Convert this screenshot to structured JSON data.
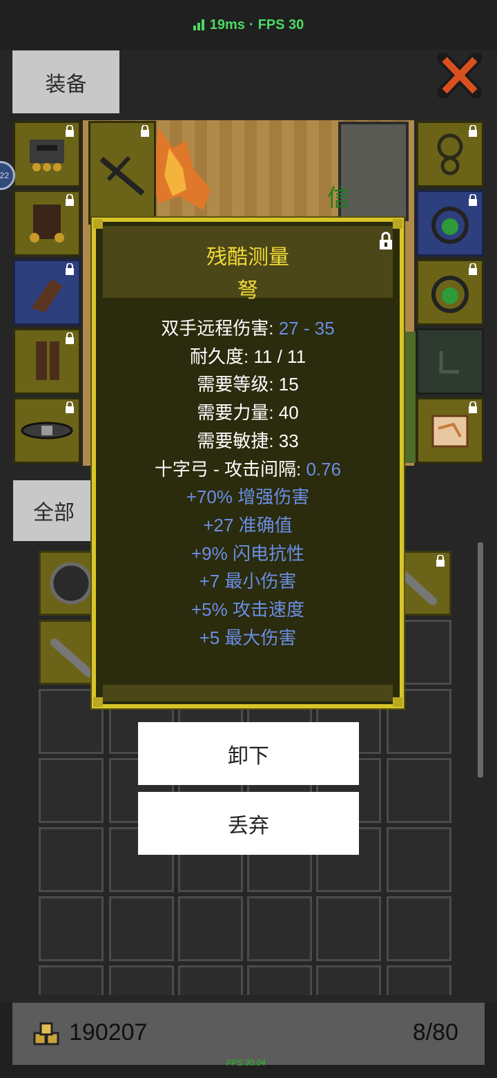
{
  "status": {
    "latency": "19ms",
    "separator": "·",
    "fps": "FPS 30"
  },
  "tabs": {
    "equipment": "装备",
    "all": "全部"
  },
  "side_badge": "22",
  "scene_text": "信",
  "tooltip": {
    "title": "残酷测量",
    "item_type": "弩",
    "lines": [
      {
        "label": "双手远程伤害: ",
        "value": "27 - 35"
      },
      {
        "label": "耐久度: 11 / 11",
        "value": ""
      },
      {
        "label": "需要等级: 15",
        "value": ""
      },
      {
        "label": "需要力量: 40",
        "value": ""
      },
      {
        "label": "需要敏捷: 33",
        "value": ""
      },
      {
        "label": "十字弓 - 攻击间隔: ",
        "value": "0.76"
      }
    ],
    "affixes": [
      "+70% 增强伤害",
      "+27 准确值",
      "+9% 闪电抗性",
      "+7 最小伤害",
      "+5% 攻击速度",
      "+5 最大伤害"
    ]
  },
  "actions": {
    "unequip": "卸下",
    "discard": "丢弃"
  },
  "footer": {
    "gold": "190207",
    "capacity": "8/80",
    "fps_overlay": "FPS:30.04"
  },
  "colors": {
    "accent_gold": "#f0da39",
    "stat_blue": "#6a8fe3",
    "fps_green": "#4cd964"
  }
}
